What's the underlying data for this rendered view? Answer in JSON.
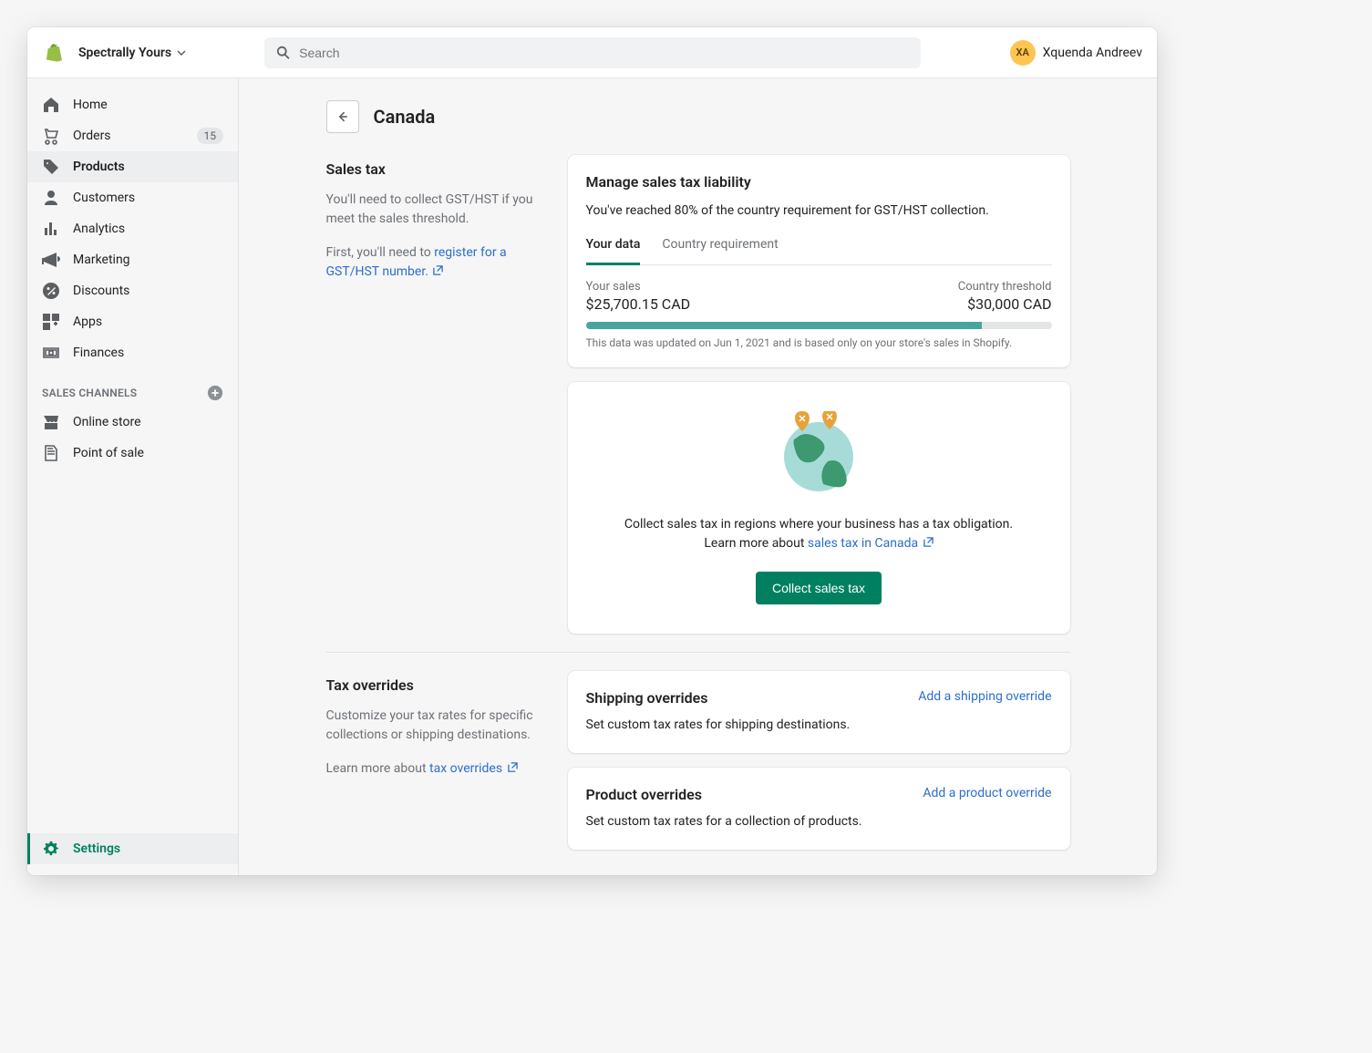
{
  "header": {
    "store_name": "Spectrally Yours",
    "search_placeholder": "Search",
    "user_initials": "XA",
    "user_name": "Xquenda Andreev"
  },
  "sidebar": {
    "items": [
      {
        "label": "Home",
        "icon": "home"
      },
      {
        "label": "Orders",
        "icon": "orders",
        "badge": "15"
      },
      {
        "label": "Products",
        "icon": "products",
        "active": true
      },
      {
        "label": "Customers",
        "icon": "customers"
      },
      {
        "label": "Analytics",
        "icon": "analytics"
      },
      {
        "label": "Marketing",
        "icon": "marketing"
      },
      {
        "label": "Discounts",
        "icon": "discounts"
      },
      {
        "label": "Apps",
        "icon": "apps"
      },
      {
        "label": "Finances",
        "icon": "finances"
      }
    ],
    "channels_header": "SALES CHANNELS",
    "channels": [
      {
        "label": "Online store"
      },
      {
        "label": "Point of sale"
      }
    ],
    "settings_label": "Settings"
  },
  "page": {
    "title": "Canada",
    "salestax": {
      "heading": "Sales tax",
      "desc": "You'll need to collect GST/HST if you meet the sales threshold.",
      "pretext": "First, you'll need to ",
      "link": "register for a GST/HST number."
    },
    "liability": {
      "heading": "Manage sales tax liability",
      "subtext": "You've reached 80% of the country requirement for GST/HST collection.",
      "tab1": "Your data",
      "tab2": "Country requirement",
      "sales_label": "Your sales",
      "sales_value": "$25,700.15 CAD",
      "threshold_label": "Country threshold",
      "threshold_value": "$30,000 CAD",
      "footnote": "This data was updated on Jun 1, 2021 and is based only on your store's sales in Shopify."
    },
    "collect": {
      "text": "Collect sales tax in regions where your business has a tax obligation. Learn more about ",
      "link": "sales tax in Canada",
      "button": "Collect sales tax"
    },
    "overrides": {
      "heading": "Tax overrides",
      "desc": "Customize your tax rates for specific collections or shipping destinations.",
      "learn_pre": "Learn more about ",
      "learn_link": "tax overrides",
      "shipping": {
        "heading": "Shipping overrides",
        "link": "Add a shipping override",
        "desc": "Set custom tax rates for shipping destinations."
      },
      "product": {
        "heading": "Product overrides",
        "link": "Add a product override",
        "desc": "Set custom tax rates for a collection of products."
      }
    }
  }
}
